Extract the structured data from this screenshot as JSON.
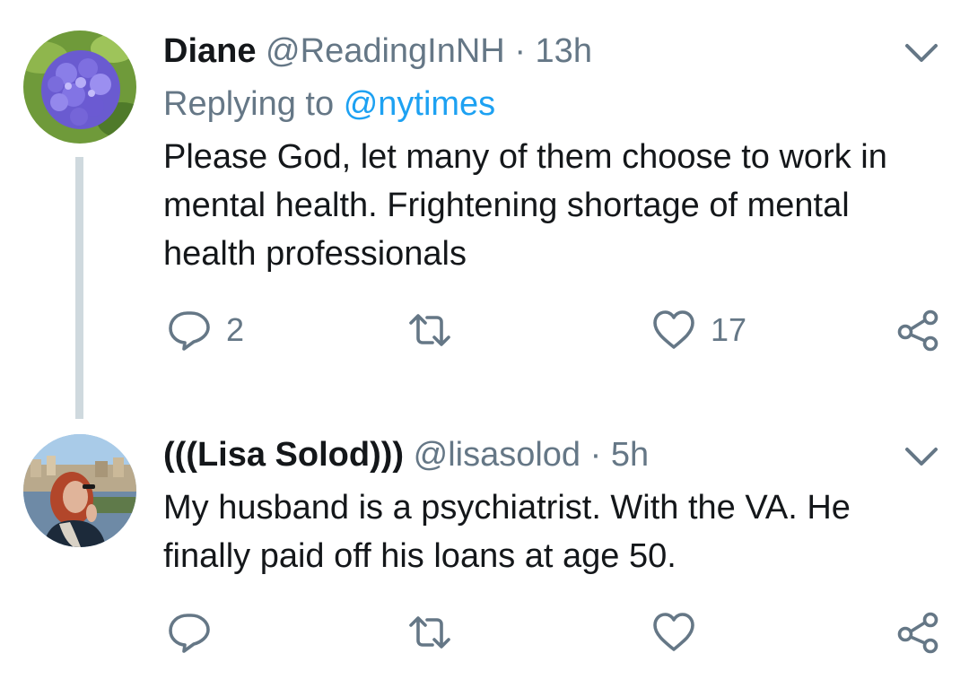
{
  "tweets": [
    {
      "display_name": "Diane",
      "handle": "@ReadingInNH",
      "separator": "·",
      "time": "13h",
      "replying_label": "Replying to",
      "replying_handle": "@nytimes",
      "text": "Please God, let many of them choose to work in mental health. Frightening shortage of mental health professionals",
      "counts": {
        "replies": "2",
        "retweets": "",
        "likes": "17"
      }
    },
    {
      "display_name": "(((Lisa Solod)))",
      "handle": "@lisasolod",
      "separator": "·",
      "time": "5h",
      "text": "My husband is a psychiatrist. With the VA. He finally paid off his loans at age 50.",
      "counts": {
        "replies": "",
        "retweets": "",
        "likes": ""
      }
    }
  ],
  "icons": {
    "reply": "reply-icon",
    "retweet": "retweet-icon",
    "like": "heart-icon",
    "share": "share-icon",
    "menu": "chevron-down-icon"
  },
  "colors": {
    "text": "#14171a",
    "secondary": "#657786",
    "link": "#1da1f2",
    "thread_line": "#cfd9de"
  }
}
